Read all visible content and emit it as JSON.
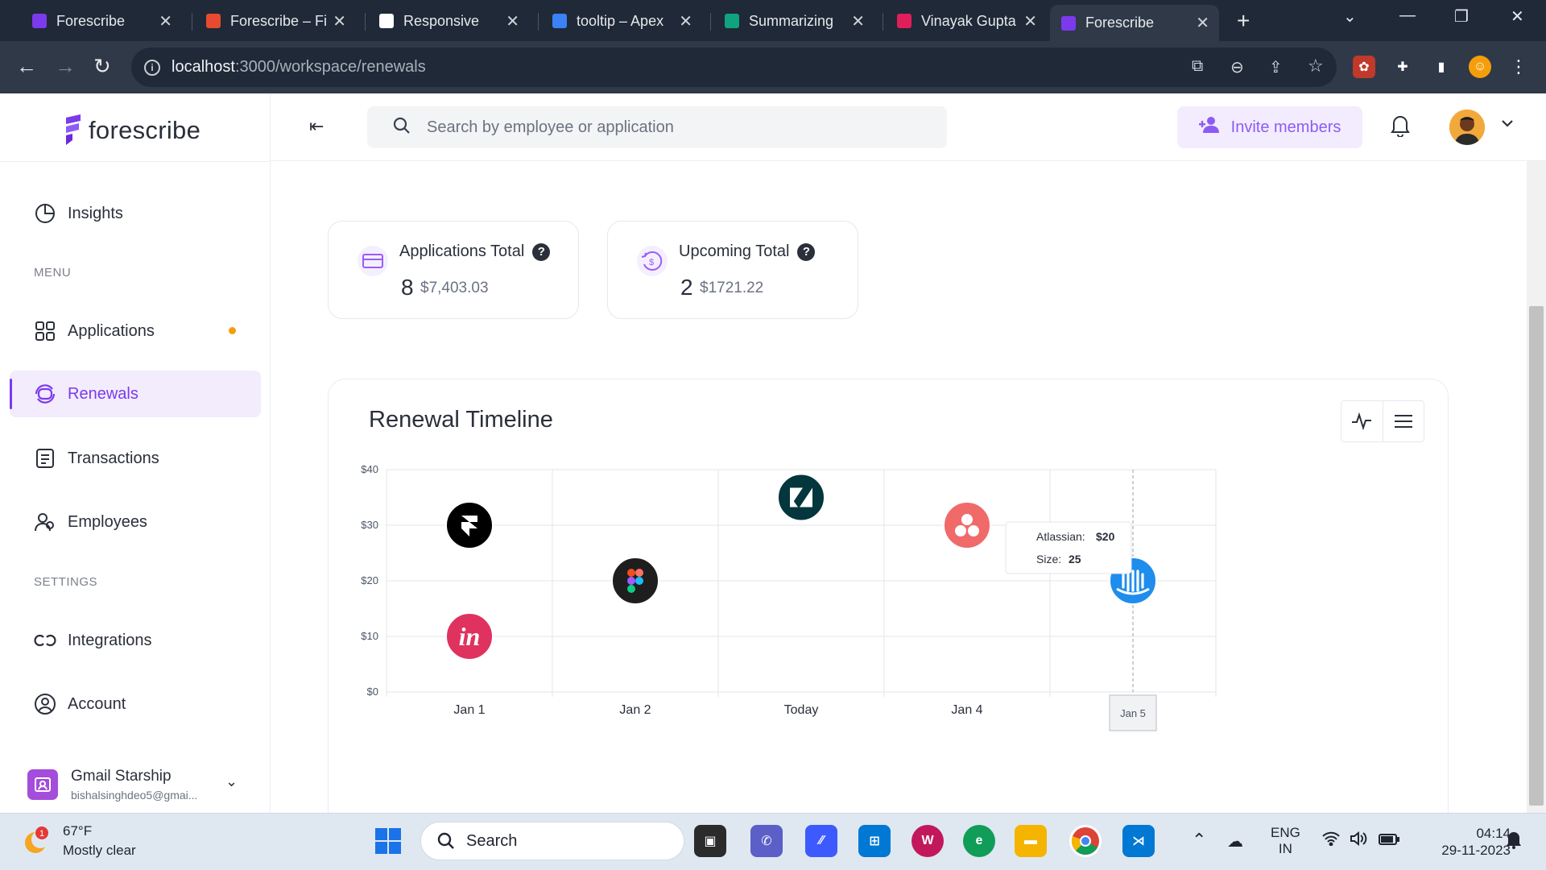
{
  "browser": {
    "tabs": [
      {
        "title": "Forescribe",
        "active": false,
        "color": "#7c3aed"
      },
      {
        "title": "Forescribe – Fi",
        "active": false,
        "color": "#e84a2f"
      },
      {
        "title": "Responsive",
        "active": false,
        "color": "#ffffff"
      },
      {
        "title": "tooltip – Apex",
        "active": false,
        "color": "#3b82f6"
      },
      {
        "title": "Summarizing",
        "active": false,
        "color": "#10a37f"
      },
      {
        "title": "Vinayak Gupta",
        "active": false,
        "color": "#e01e5a"
      },
      {
        "title": "Forescribe",
        "active": true,
        "color": "#7c3aed"
      }
    ],
    "url_host": "localhost",
    "url_path": ":3000/workspace/renewals"
  },
  "brand": {
    "name": "forescribe",
    "color": "#7c3aed"
  },
  "sidebar": {
    "top_item": {
      "label": "Insights"
    },
    "menu_label": "MENU",
    "menu_items": [
      {
        "label": "Applications",
        "badge": true
      },
      {
        "label": "Renewals",
        "active": true
      },
      {
        "label": "Transactions"
      },
      {
        "label": "Employees"
      }
    ],
    "settings_label": "SETTINGS",
    "settings_items": [
      {
        "label": "Integrations"
      },
      {
        "label": "Account"
      }
    ],
    "workspace": {
      "name": "Gmail Starship",
      "email": "bishalsinghdeo5@gmai..."
    }
  },
  "topbar": {
    "search_placeholder": "Search by employee or application",
    "invite_label": "Invite members"
  },
  "stats": [
    {
      "title": "Applications Total",
      "count": "8",
      "amount": "$7,403.03"
    },
    {
      "title": "Upcoming Total",
      "count": "2",
      "amount": "$1721.22"
    }
  ],
  "timeline": {
    "title": "Renewal Timeline"
  },
  "chart_data": {
    "type": "scatter",
    "title": "Renewal Timeline",
    "categories": [
      "Jan 1",
      "Jan 2",
      "Today",
      "Jan 4",
      "Jan 5"
    ],
    "ylim": [
      0,
      40
    ],
    "yticks": [
      "$0",
      "$10",
      "$20",
      "$30",
      "$40"
    ],
    "grid": true,
    "points": [
      {
        "app": "Framer",
        "x": "Jan 1",
        "y": 30,
        "color": "#000000"
      },
      {
        "app": "InVision",
        "x": "Jan 1",
        "y": 10,
        "color": "#e0325f"
      },
      {
        "app": "Figma",
        "x": "Jan 2",
        "y": 20,
        "color": "#1e1e1e"
      },
      {
        "app": "Zendesk",
        "x": "Today",
        "y": 35,
        "color": "#03363d"
      },
      {
        "app": "Asana",
        "x": "Jan 4",
        "y": 30,
        "color": "#f06a6a"
      },
      {
        "app": "Intercom",
        "x": "Jan 5",
        "y": 20,
        "color": "#1f8ded"
      }
    ],
    "tooltip": {
      "label": "Atlassian:",
      "value": "$20",
      "size_label": "Size:",
      "size_value": "25"
    },
    "crosshair_label": "Jan 5"
  },
  "taskbar": {
    "weather_temp": "67°F",
    "weather_cond": "Mostly clear",
    "weather_badge": "1",
    "search_label": "Search",
    "lang_1": "ENG",
    "lang_2": "IN",
    "time": "04:14",
    "date": "29-11-2023"
  }
}
